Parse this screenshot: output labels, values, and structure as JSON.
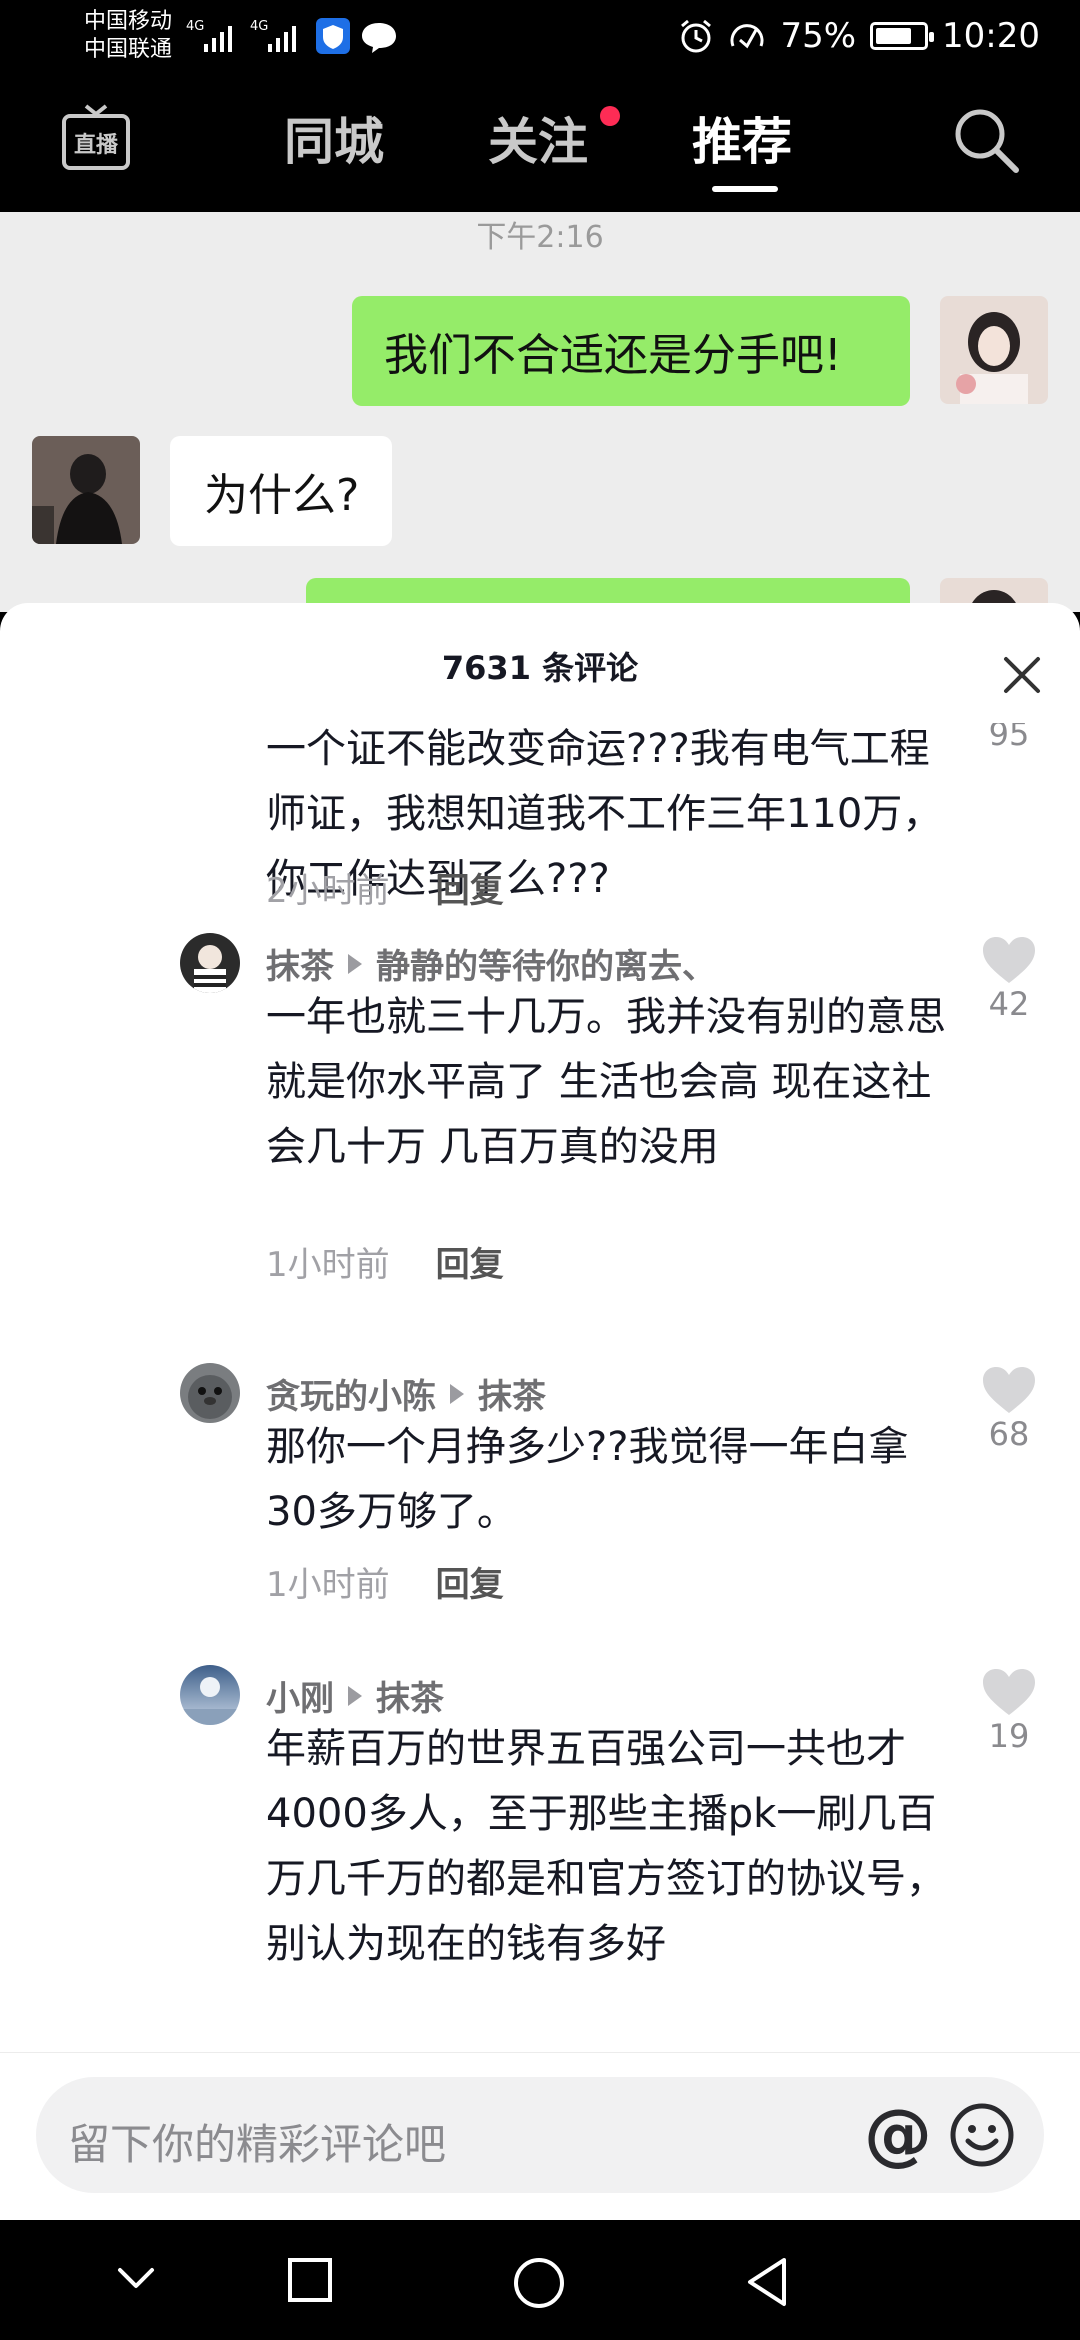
{
  "status_bar": {
    "carrier_1": "中国移动",
    "carrier_2": "中国联通",
    "net_1": "4G",
    "net_2": "4G",
    "battery_percent": "75%",
    "battery_level": 0.75,
    "time": "10:20"
  },
  "top_nav": {
    "live_label": "直播",
    "tabs": [
      "同城",
      "关注",
      "推荐"
    ],
    "active_tab": "推荐",
    "follow_has_dot": true
  },
  "chat": {
    "timestamp": "下午2:16",
    "messages": [
      {
        "side": "right",
        "text": "我们不合适还是分手吧!"
      },
      {
        "side": "left",
        "text": "为什么?"
      }
    ]
  },
  "comments_sheet": {
    "title": "7631 条评论",
    "comments": [
      {
        "text": "一个证不能改变命运???我有电气工程师证，我想知道我不工作三年110万，你工作达到了么???",
        "time": "2小时前",
        "reply_label": "回复",
        "likes": "95"
      },
      {
        "user": "抹茶",
        "reply_to": "静静的等待你的离去、",
        "text": "一年也就三十几万。我并没有别的意思就是你水平高了 生活也会高 现在这社会几十万 几百万真的没用",
        "time": "1小时前",
        "reply_label": "回复",
        "likes": "42"
      },
      {
        "user": "贪玩的小陈",
        "reply_to": "抹茶",
        "text": "那你一个月挣多少??我觉得一年白拿30多万够了。",
        "time": "1小时前",
        "reply_label": "回复",
        "likes": "68"
      },
      {
        "user": "小刚",
        "reply_to": "抹茶",
        "text": "年薪百万的世界五百强公司一共也才4000多人，至于那些主播pk一刷几百万几千万的都是和官方签订的协议号，别认为现在的钱有多好",
        "likes": "19"
      }
    ]
  },
  "input_bar": {
    "placeholder": "留下你的精彩评论吧",
    "at_symbol": "@"
  },
  "colors": {
    "green_bubble": "#95ec69",
    "accent_dot": "#fe2c55"
  }
}
